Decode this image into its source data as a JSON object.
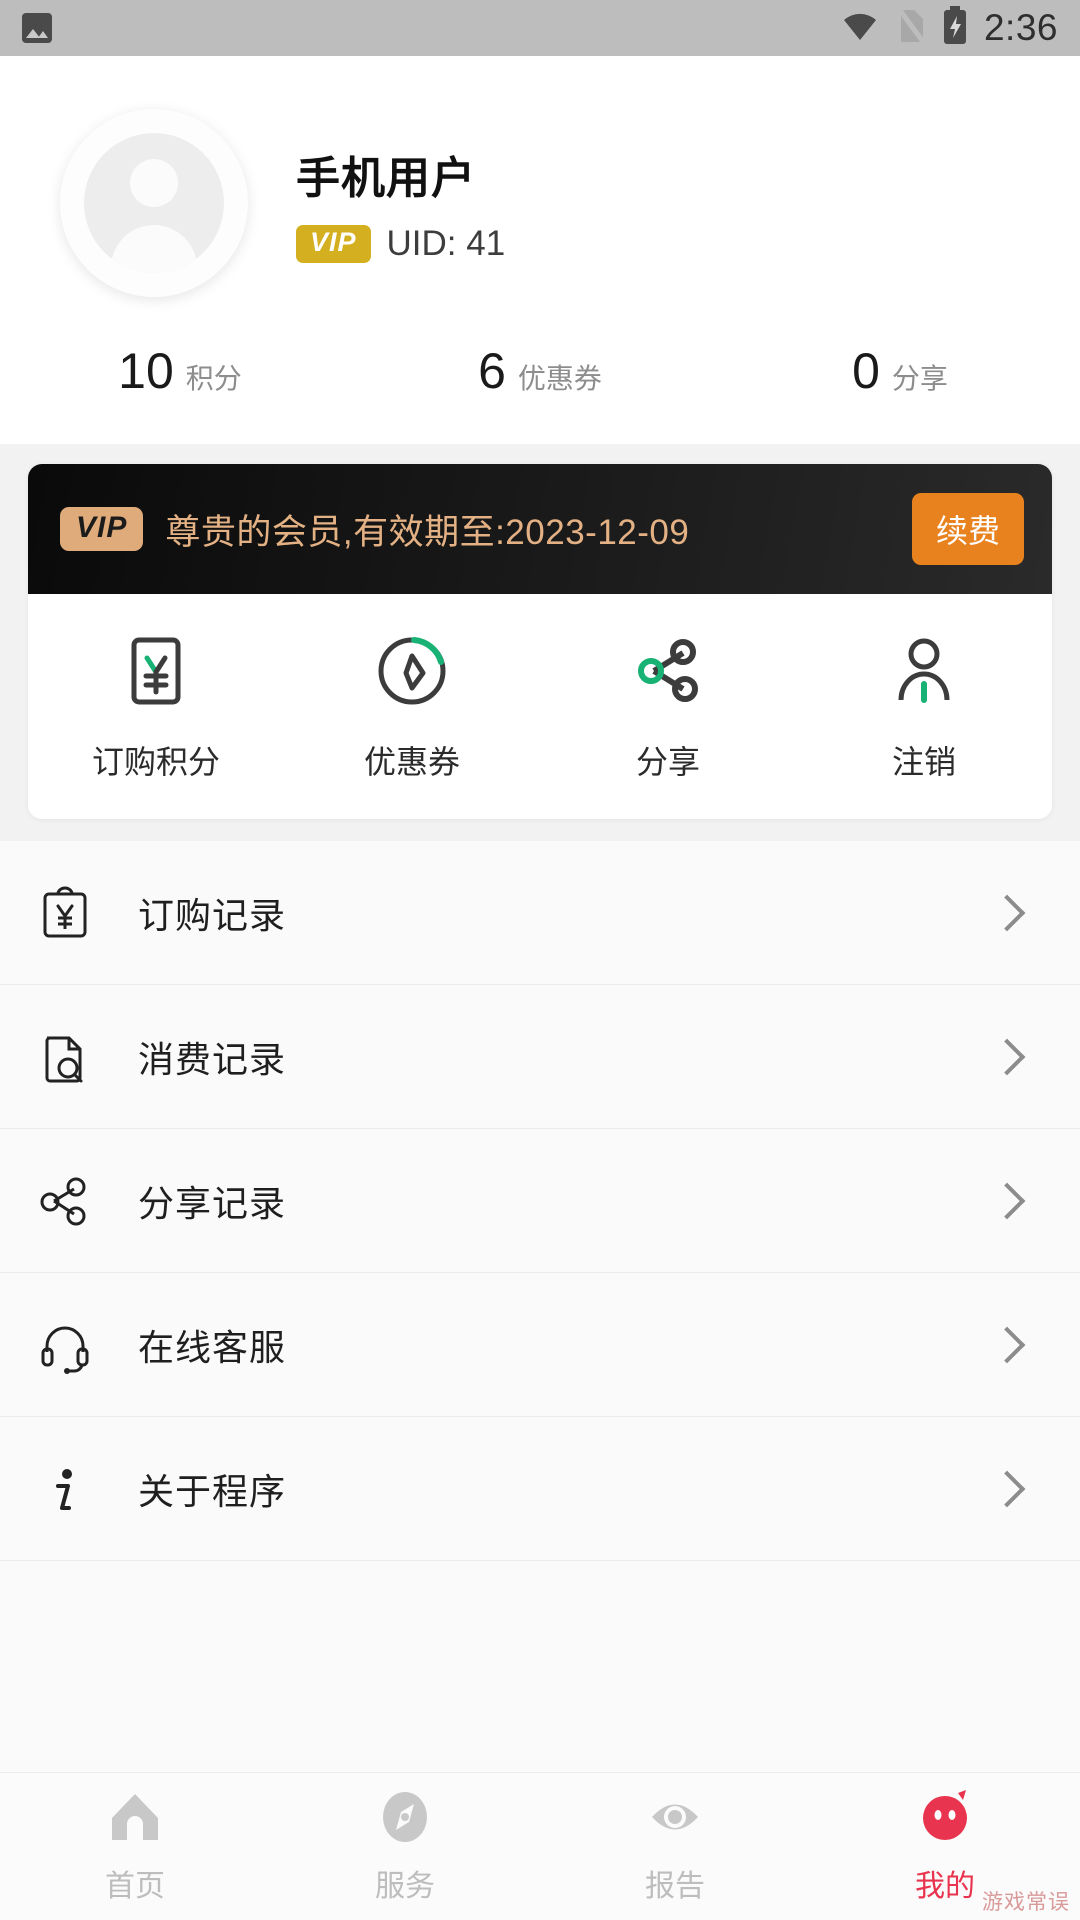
{
  "status_bar": {
    "time": "2:36",
    "icons": [
      "photo-icon",
      "wifi-icon",
      "sim-off-icon",
      "battery-charging-icon"
    ]
  },
  "profile": {
    "avatar_icon": "person-placeholder-icon",
    "user_name": "手机用户",
    "vip_badge": "VIP",
    "uid_text": "UID: 41",
    "stats": [
      {
        "value": "10",
        "label": "积分"
      },
      {
        "value": "6",
        "label": "优惠券"
      },
      {
        "value": "0",
        "label": "分享"
      }
    ]
  },
  "vip_panel": {
    "badge": "VIP",
    "message": "尊贵的会员,有效期至:2023-12-09",
    "renew_label": "续费",
    "banner_bg": "#0f0f0f",
    "banner_text_color": "#e3b184",
    "renew_color": "#e8821f",
    "quick_actions": [
      {
        "label": "订购积分",
        "icon": "yen-card-icon"
      },
      {
        "label": "优惠券",
        "icon": "coupon-compass-icon"
      },
      {
        "label": "分享",
        "icon": "share-nodes-icon"
      },
      {
        "label": "注销",
        "icon": "logout-person-icon"
      }
    ],
    "accent_color": "#17b274"
  },
  "menu": {
    "items": [
      {
        "label": "订购记录",
        "icon": "clipboard-yen-icon"
      },
      {
        "label": "消费记录",
        "icon": "document-search-icon"
      },
      {
        "label": "分享记录",
        "icon": "share-nodes-icon"
      },
      {
        "label": "在线客服",
        "icon": "headset-icon"
      },
      {
        "label": "关于程序",
        "icon": "info-icon"
      }
    ]
  },
  "tab_bar": {
    "items": [
      {
        "label": "首页",
        "icon": "home-icon",
        "active": false
      },
      {
        "label": "服务",
        "icon": "compass-icon",
        "active": false
      },
      {
        "label": "报告",
        "icon": "eye-icon",
        "active": false
      },
      {
        "label": "我的",
        "icon": "profile-icon",
        "active": true
      }
    ],
    "active_color": "#e8344e",
    "inactive_color": "#c8c8c8"
  },
  "watermark": "游戏常误"
}
